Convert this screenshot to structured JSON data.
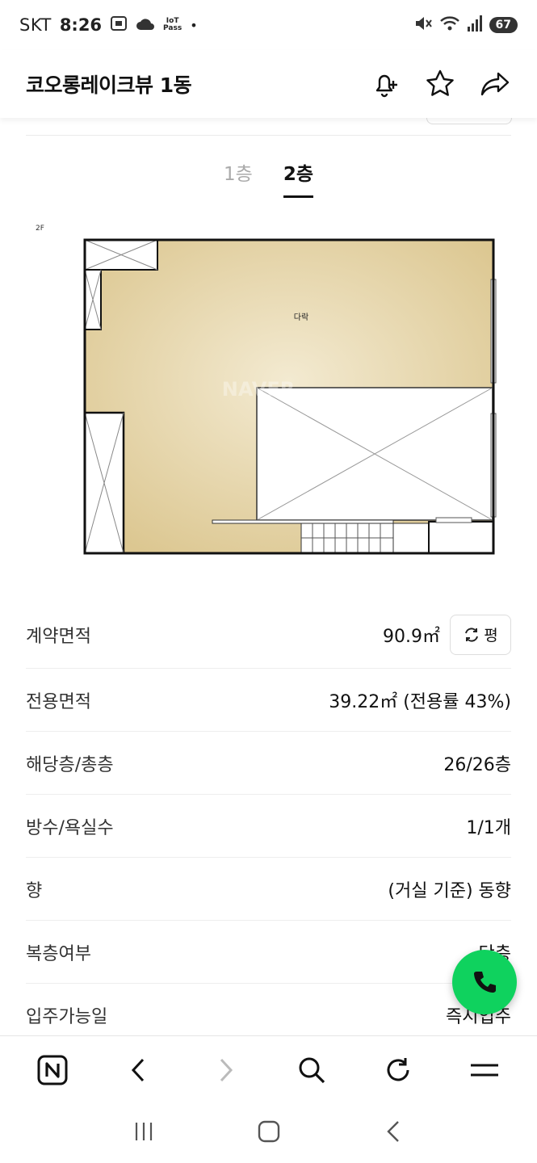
{
  "status_bar": {
    "carrier": "SKT",
    "time": "8:26",
    "iot_top": "IoT",
    "iot_bottom": "Pass",
    "dot": "•",
    "battery": "67"
  },
  "header": {
    "title": "코오롱레이크뷰 1동"
  },
  "floor_tabs": [
    {
      "label": "1층",
      "active": false
    },
    {
      "label": "2층",
      "active": true
    }
  ],
  "floorplan": {
    "floor_label": "2F",
    "room_label": "다락",
    "watermark": "NAVER"
  },
  "info": {
    "contract_area_label": "계약면적",
    "contract_area_value": "90.9㎡",
    "unit_toggle_label": "평",
    "exclusive_area_label": "전용면적",
    "exclusive_area_value": "39.22㎡ (전용률 43%)",
    "floor_label": "해당층/총층",
    "floor_value": "26/26층",
    "rooms_label": "방수/욕실수",
    "rooms_value": "1/1개",
    "direction_label": "향",
    "direction_value": "(거실 기준) 동향",
    "duplex_label": "복층여부",
    "duplex_value": "단층",
    "movein_label": "입주가능일",
    "movein_value": "즉시입주"
  },
  "colors": {
    "call_green": "#0fd25e",
    "floor_fill": "#e4d2a0"
  }
}
